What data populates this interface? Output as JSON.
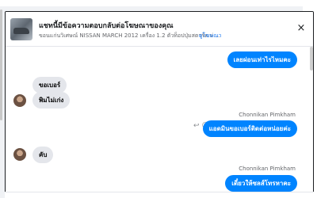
{
  "header": {
    "title": "แชทนี้มีข้อความตอบกลับต่อโฆษณาของคุณ",
    "subtitle": "ขอนแก่นวิเศษณ์ NISSAN MARCH 2012 เครื่อง 1.2 ตัวท็อปปุ่มสตาร์ท ผ่ ...",
    "ad_link": "ดูโฆษณา",
    "close_glyph": "×"
  },
  "messages": [
    {
      "text": "เลยผ่อนเท่าไรไหมคะ",
      "side": "out"
    },
    {
      "text": "ขอเบอร์",
      "side": "in"
    },
    {
      "text": "พิมไม่เก่ง",
      "side": "in"
    },
    {
      "sender": "Chonnikan Pimkham",
      "text": "แอดมินขอเบอร์ติดต่อหน่อยค่ะ",
      "side": "out",
      "icons": [
        "reply-icon",
        "emoji-icon"
      ]
    },
    {
      "text": "คับ",
      "side": "in"
    },
    {
      "sender": "Chonnikan Pimkham",
      "text": "เดี๋ยวให้ซลส์โทรหาคะ",
      "side": "out"
    }
  ],
  "icons": {
    "reply_glyph": "↩",
    "emoji_glyph": "☺"
  },
  "colors": {
    "accent": "#0084ff",
    "incoming": "#e4e6eb",
    "link": "#1877f2"
  }
}
